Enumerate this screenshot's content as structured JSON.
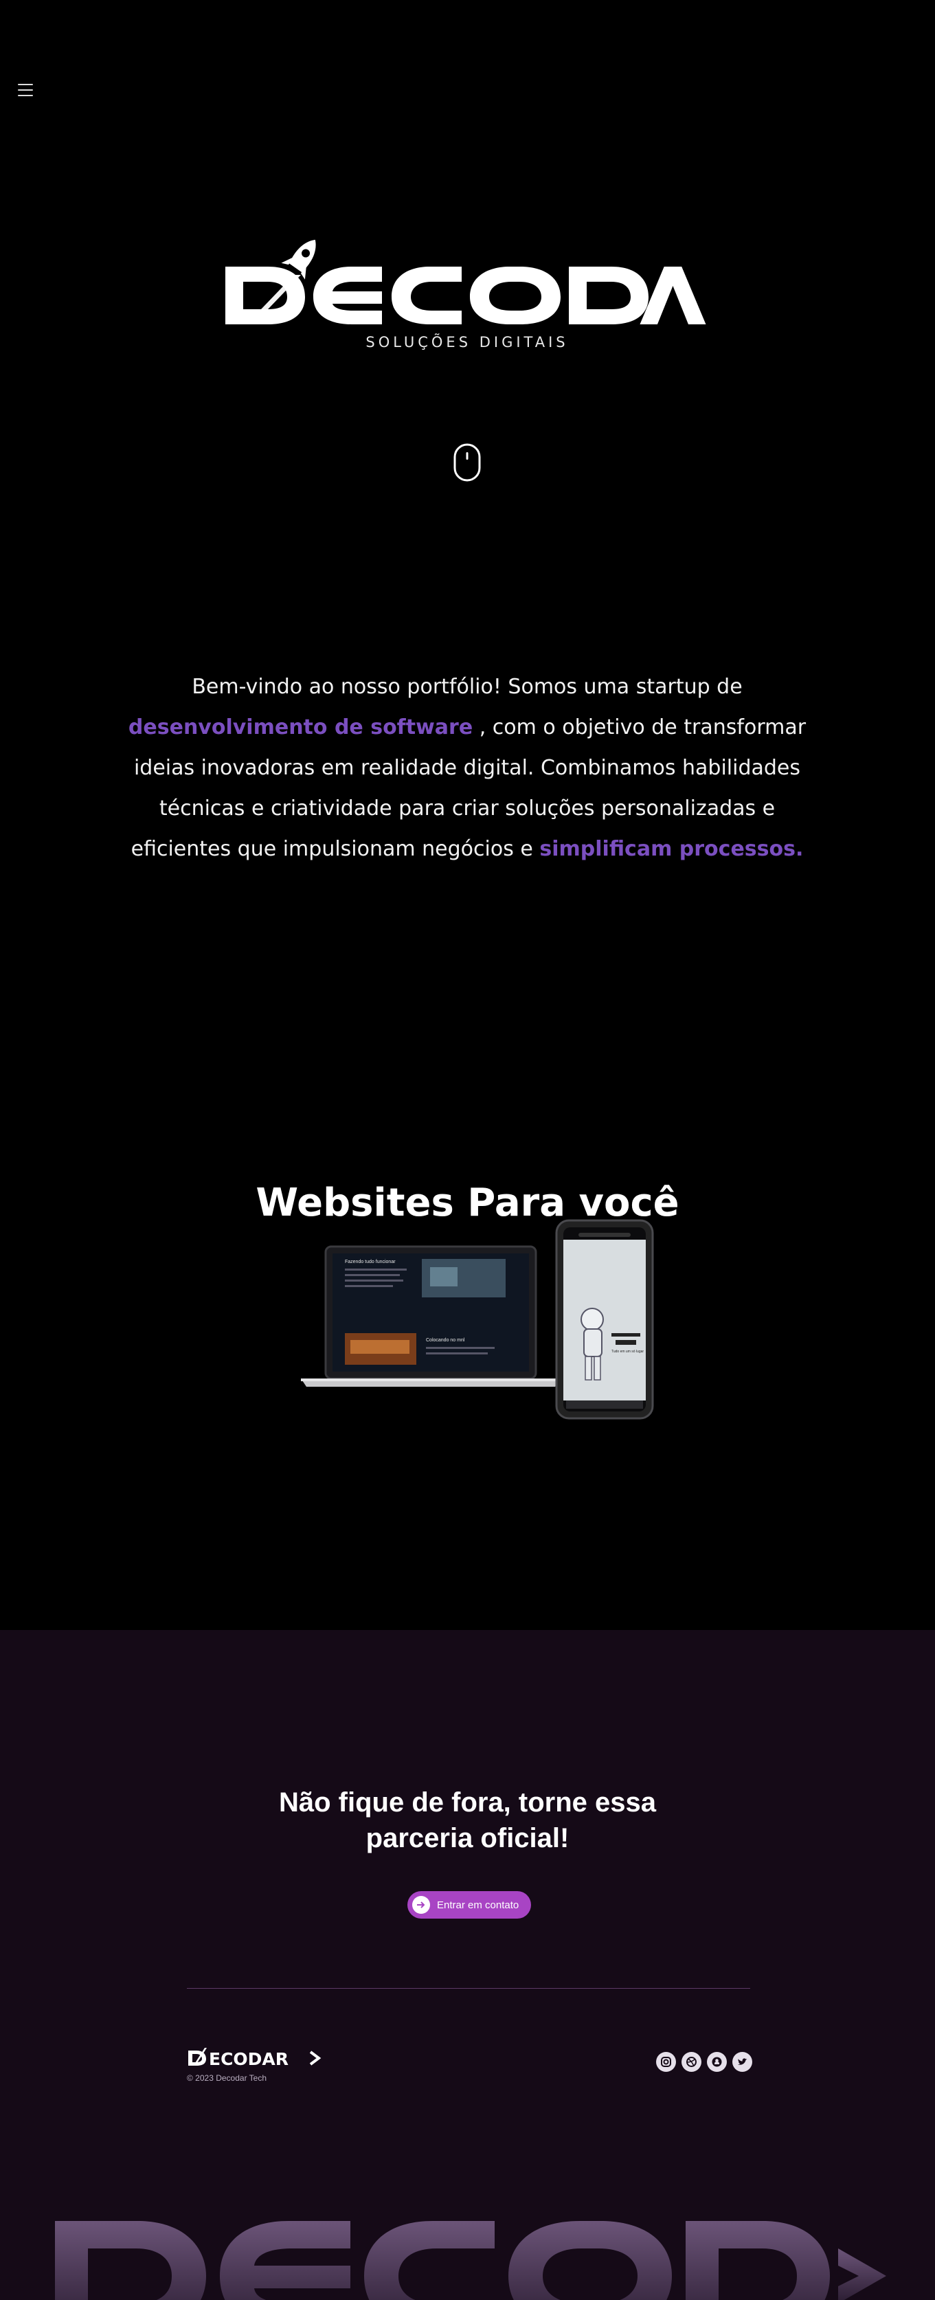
{
  "nav": {
    "menu_icon": "hamburger-menu-icon"
  },
  "hero": {
    "brand": "DECODAR",
    "tagline": "SOLUÇÕES DIGITAIS",
    "scroll_icon": "mouse-scroll-icon"
  },
  "intro": {
    "part1": "Bem-vindo ao nosso portfólio! Somos uma startup de",
    "highlight1": "desenvolvimento de software",
    "part2": ", com o objetivo de transformar ideias inovadoras em realidade digital. Combinamos habilidades técnicas e criatividade para criar soluções personalizadas e eficientes que impulsionam negócios e",
    "highlight2": "simplificam processos."
  },
  "websites": {
    "title": "Websites Para você",
    "laptop_screen_title": "Fazendo tudo funcionar",
    "laptop_screen_caption": "Colocando no mnl",
    "phone_screen_text": "Tudo em um só lugar"
  },
  "cta": {
    "title_line1": "Não fique de fora, torne essa",
    "title_line2": "parceria oficial!",
    "button_label": "Entrar em contato",
    "button_icon": "arrow-right-icon"
  },
  "footer": {
    "logo": "DECODAR>",
    "copyright": "© 2023 Decodar Tech",
    "socials": [
      "instagram-icon",
      "dribbble-icon",
      "github-icon",
      "twitter-icon"
    ],
    "big_logo": "DECODAR>"
  },
  "colors": {
    "background": "#000000",
    "accent_purple": "#7b4fc0",
    "cta_button": "#a844c4",
    "footer_background": "#150a17"
  }
}
